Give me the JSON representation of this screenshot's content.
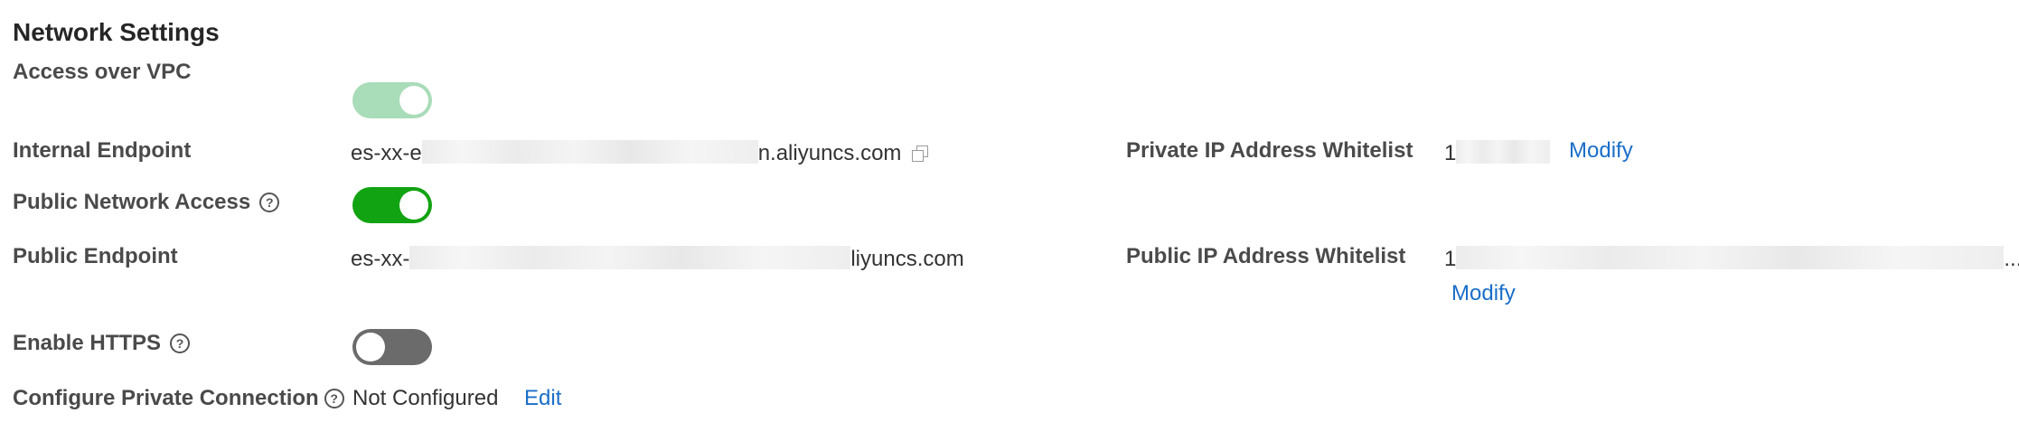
{
  "section": {
    "title": "Network Settings"
  },
  "vpc": {
    "label": "Access over VPC",
    "enabled": true,
    "disabled": true
  },
  "internal_endpoint": {
    "label": "Internal Endpoint",
    "prefix": "es-xx-e",
    "suffix": "n.aliyuncs.com"
  },
  "private_whitelist": {
    "label": "Private IP Address Whitelist",
    "prefix": "1",
    "action": "Modify"
  },
  "public_access": {
    "label": "Public Network Access",
    "enabled": true
  },
  "public_endpoint": {
    "label": "Public Endpoint",
    "prefix": "es-xx-",
    "suffix": "liyuncs.com"
  },
  "public_whitelist": {
    "label": "Public IP Address Whitelist",
    "prefix": "1",
    "ellipsis": "...",
    "action": "Modify"
  },
  "https": {
    "label": "Enable HTTPS",
    "enabled": false
  },
  "private_connection": {
    "label": "Configure Private Connection",
    "status": "Not Configured",
    "action": "Edit"
  },
  "icons": {
    "help": "?",
    "copy": "copy-icon"
  },
  "colors": {
    "link": "#1a6ec8",
    "toggle_on": "#12a312",
    "toggle_on_disabled": "#a9dcb8",
    "toggle_off": "#6b6b6b"
  }
}
